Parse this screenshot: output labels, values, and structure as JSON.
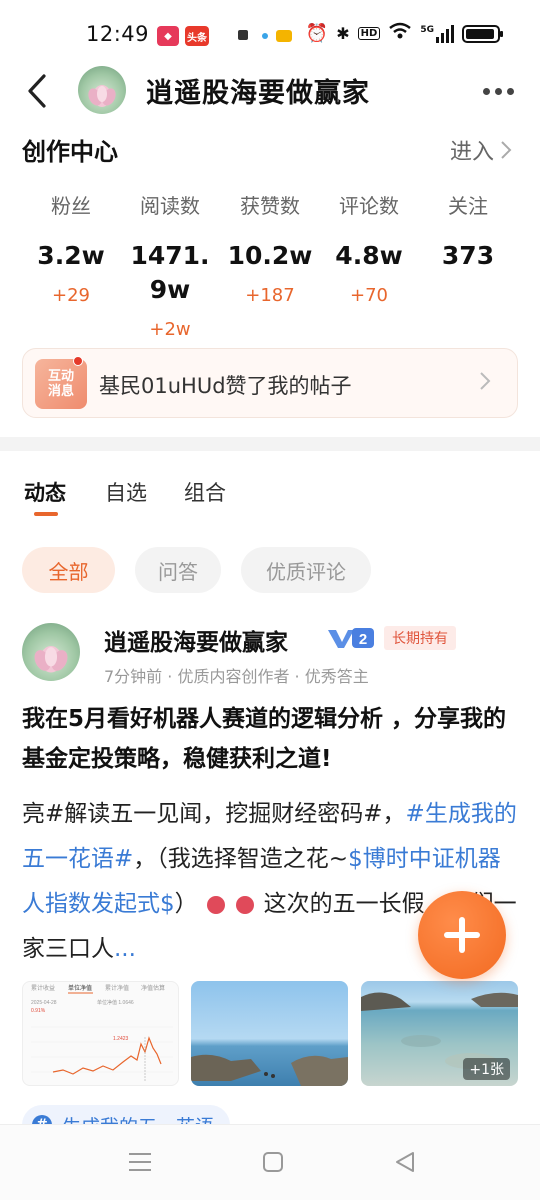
{
  "status_bar": {
    "time": "12:49",
    "app_badges": [
      "头条"
    ],
    "network": "5G"
  },
  "header": {
    "title": "逍遥股海要做赢家"
  },
  "creation_center": {
    "title": "创作中心",
    "enter_label": "进入",
    "stats": [
      {
        "label": "粉丝",
        "value": "3.2w",
        "delta": "+29"
      },
      {
        "label": "阅读数",
        "value": "1471.9w",
        "delta": "+2w"
      },
      {
        "label": "获赞数",
        "value": "10.2w",
        "delta": "+187"
      },
      {
        "label": "评论数",
        "value": "4.8w",
        "delta": "+70"
      },
      {
        "label": "关注",
        "value": "373",
        "delta": ""
      }
    ],
    "notice": {
      "badge_top": "互动",
      "badge_bottom": "消息",
      "text": "基民01uHUd赞了我的帖子"
    }
  },
  "tabs": [
    {
      "label": "动态",
      "active": true
    },
    {
      "label": "自选",
      "active": false
    },
    {
      "label": "组合",
      "active": false
    }
  ],
  "filters": [
    {
      "label": "全部",
      "active": true
    },
    {
      "label": "问答",
      "active": false
    },
    {
      "label": "优质评论",
      "active": false
    }
  ],
  "post": {
    "author": "逍遥股海要做赢家",
    "level_badge": "2",
    "hold_badge": "长期持有",
    "meta": "7分钟前 · 优质内容创作者 · 优秀答主",
    "title": "我在5月看好机器人赛道的逻辑分析 ，分享我的基金定投策略，稳健获利之道!",
    "body_part1": "亮#解读五一见闻，挖掘财经密码#，",
    "body_link1": "#生成我的五一花语#",
    "body_part2": "，（我选择智造之花~",
    "body_link2": "$博时中证机器人指数发起式$",
    "body_part3": "）",
    "body_part4": "这次的五一长假，我们一家三口人",
    "more_dots": "...",
    "image_more": "+1张",
    "chart_thumb": {
      "tabs": [
        "累计收益",
        "单位净值",
        "累计净值",
        "净值估算"
      ],
      "date": "2025-04-28",
      "gain": "0.91%",
      "nav_label": "单位净值 1.0646",
      "peak": "1.2423"
    },
    "topic": "生成我的五一花语"
  },
  "colors": {
    "accent": "#e8662d",
    "link": "#3a7bd5",
    "fab": "#f26a21"
  }
}
